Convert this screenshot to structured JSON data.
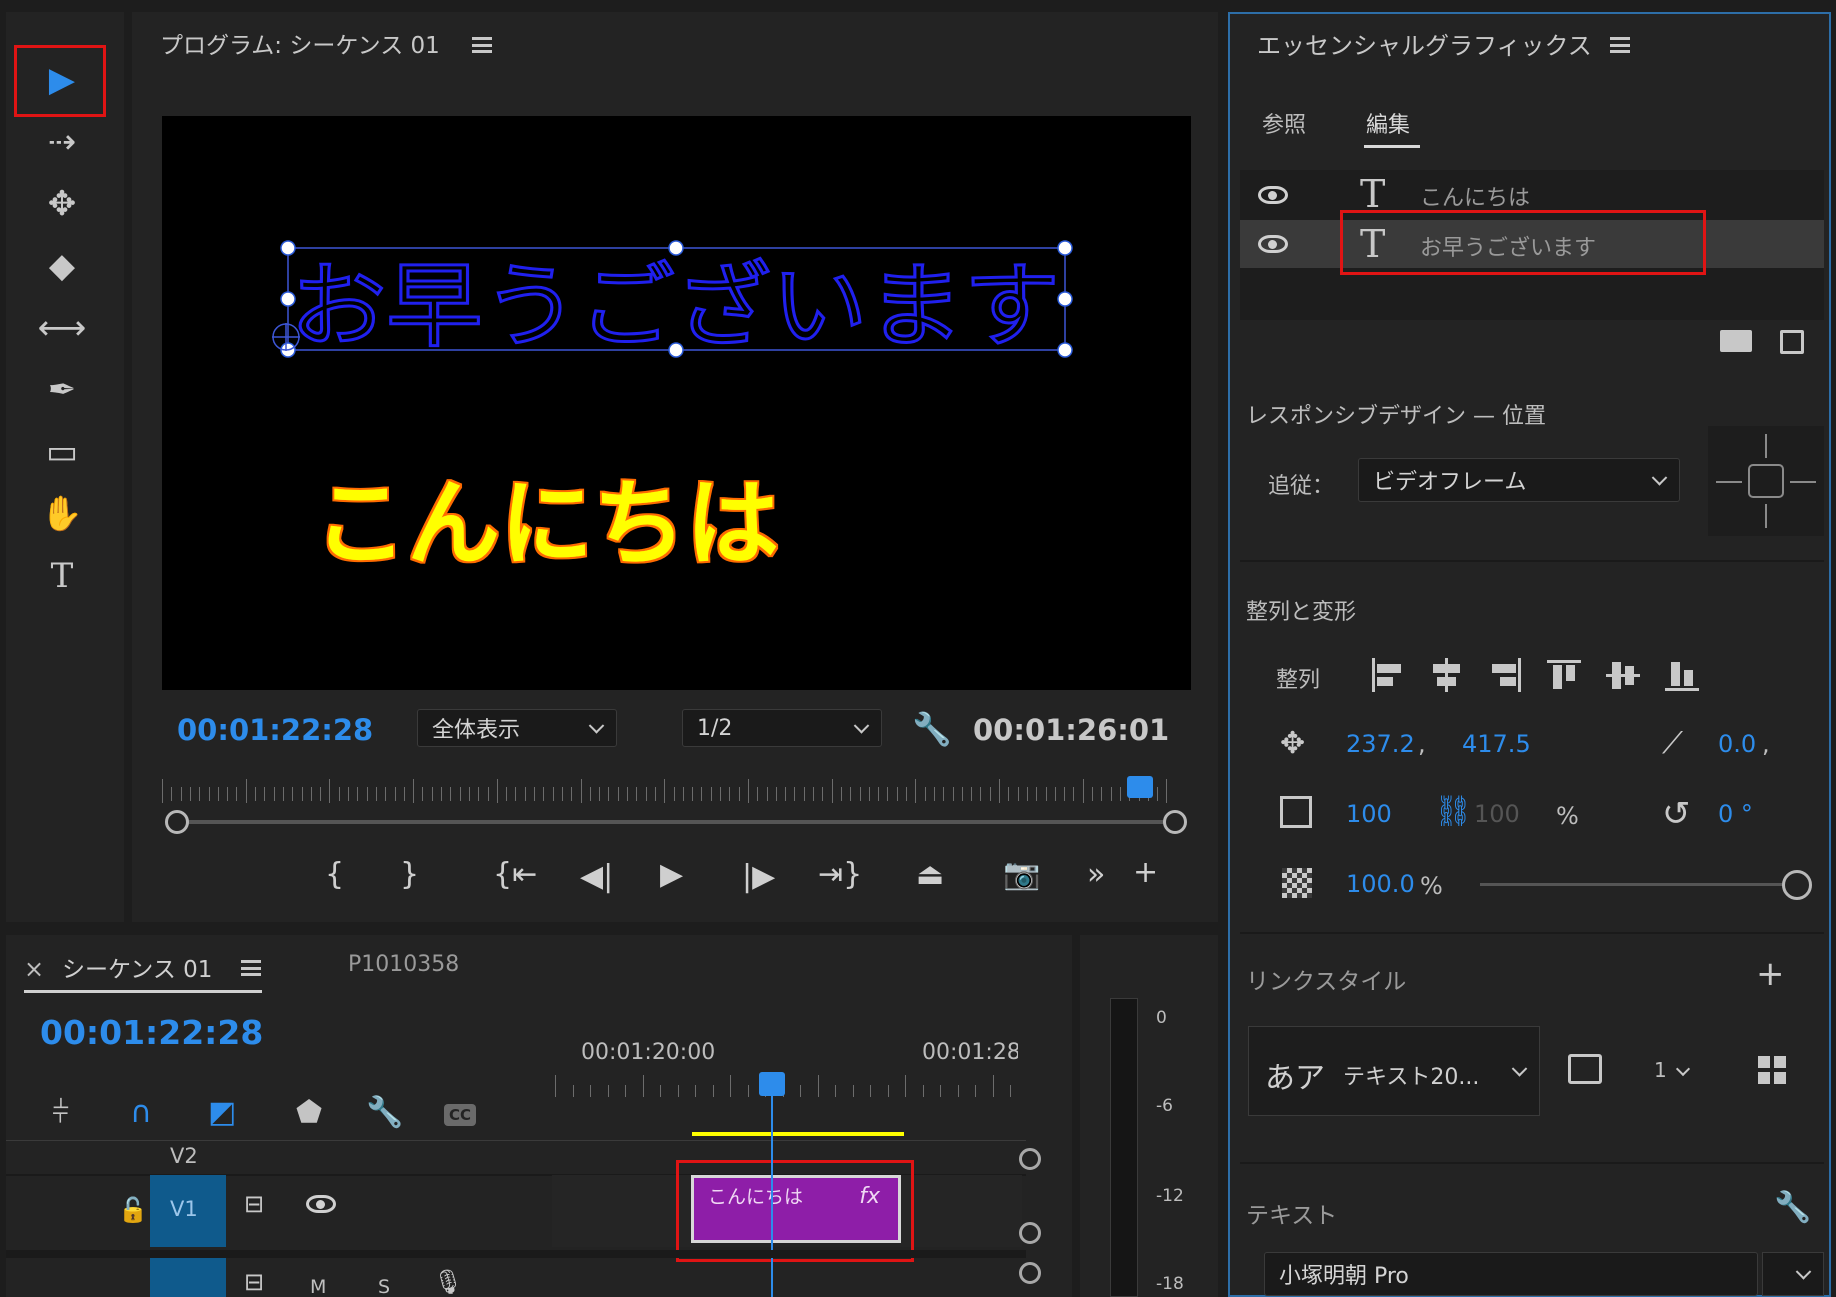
{
  "toolbar": {
    "tools": [
      {
        "name": "selection-tool",
        "glyph": "▶",
        "active": true
      },
      {
        "name": "track-select-tool",
        "glyph": "⇢"
      },
      {
        "name": "ripple-edit-tool",
        "glyph": "✥"
      },
      {
        "name": "razor-tool",
        "glyph": "◆"
      },
      {
        "name": "slip-tool",
        "glyph": "⟷"
      },
      {
        "name": "pen-tool",
        "glyph": "✒"
      },
      {
        "name": "rectangle-tool",
        "glyph": "▭"
      },
      {
        "name": "hand-tool",
        "glyph": "✋"
      },
      {
        "name": "type-tool",
        "glyph": "T"
      }
    ]
  },
  "program_monitor": {
    "title": "プログラム: シーケンス 01",
    "text_layer_1": "お早うございます",
    "text_layer_2": "こんにちは",
    "current_time": "00:01:22:28",
    "zoom": "全体表示",
    "resolution": "1/2",
    "duration": "00:01:26:01",
    "playhead_fraction": 0.96
  },
  "timeline": {
    "close": "×",
    "tab_label": "シーケンス 01",
    "second_tab": "P1010358",
    "current_time": "00:01:22:28",
    "ruler_labels": [
      "00:01:20:00",
      "00:01:28"
    ],
    "tracks": [
      {
        "name": "V2"
      },
      {
        "name": "V1"
      }
    ],
    "clip_label": "こんにちは",
    "clip_fx": "fx",
    "track_buttons": [
      "M",
      "S"
    ],
    "meter_labels": [
      "0",
      "-6",
      "-12",
      "-18"
    ],
    "cc_label": "CC"
  },
  "essential_graphics": {
    "title": "エッセンシャルグラフィックス",
    "tabs": [
      "参照",
      "編集"
    ],
    "active_tab": "編集",
    "layers": [
      {
        "name": "こんにちは",
        "selected": false
      },
      {
        "name": "お早うございます",
        "selected": true
      }
    ],
    "responsive_title": "レスポンシブデザイン — 位置",
    "follow_label": "追従：",
    "follow_value": "ビデオフレーム",
    "align_title": "整列と変形",
    "align_label": "整列",
    "pos_x": "237.2",
    "pos_y": "417.5",
    "comma": ",",
    "anchor": "0.0",
    "scale": "100",
    "scale_h": "100",
    "percent": "%",
    "rotation": "0 °",
    "opacity": "100.0",
    "link_style_title": "リンクスタイル",
    "style_preview": "あア",
    "style_name": "テキスト20...",
    "style_count": "1",
    "text_title": "テキスト",
    "font": "小塚明朝 Pro"
  },
  "colors": {
    "accent": "#2d8ceb",
    "highlight_red": "#e01414",
    "title_blue": "#1e1ee6",
    "title_yellow": "#ffff00",
    "title_outline_orange": "#ff6a00",
    "clip_purple": "#8e1ea8",
    "track_blue": "#0f5a8c"
  }
}
